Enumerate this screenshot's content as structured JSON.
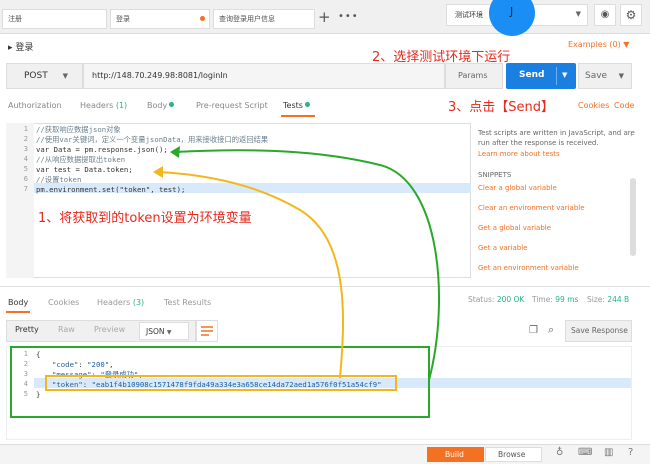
{
  "tabs": [
    {
      "label": "注册"
    },
    {
      "label": "登录"
    },
    {
      "label": "查询登录用户信息"
    }
  ],
  "environment": {
    "selected": "测试环境"
  },
  "avatar": {
    "label": "J"
  },
  "request": {
    "title": "登录",
    "examples": "Examples (0)",
    "method": "POST",
    "url": "http://148.70.249.98:8081/loginIn",
    "params": "Params",
    "send": "Send",
    "save": "Save"
  },
  "request_tabs": {
    "authorization": "Authorization",
    "headers": "Headers",
    "headers_count": "(1)",
    "body": "Body",
    "prerequest": "Pre-request Script",
    "tests": "Tests",
    "cookies": "Cookies",
    "code": "Code"
  },
  "annotations": {
    "step1": "1、将获取到的token设置为环境变量",
    "step2": "2、选择测试环境下运行",
    "step3": "3、点击【Send】"
  },
  "tests_code": {
    "line_numbers": [
      "1",
      "2",
      "3",
      "4",
      "5",
      "6",
      "7"
    ],
    "lines": [
      "//获取响应数据json对象",
      "//使用var关键词，定义一个变量jsonData，用来接收接口的返回结果",
      "var Data = pm.response.json();",
      "//从响应数据提取出token",
      "var test = Data.token;",
      "//设置token",
      "pm.environment.set(\"token\", test);"
    ]
  },
  "snippets_panel": {
    "description_1": "Test scripts are written in JavaScript, and are",
    "description_2": "run after the response is received.",
    "learn_more": "Learn more about tests",
    "heading": "SNIPPETS",
    "items": [
      "Clear a global variable",
      "Clear an environment variable",
      "Get a global variable",
      "Get a variable",
      "Get an environment variable"
    ]
  },
  "response_tabs": {
    "body": "Body",
    "cookies": "Cookies",
    "headers": "Headers",
    "headers_count": "(3)",
    "test_results": "Test Results"
  },
  "response_status": {
    "status_label": "Status:",
    "status_value": "200 OK",
    "time_label": "Time:",
    "time_value": "99 ms",
    "size_label": "Size:",
    "size_value": "244 B"
  },
  "response_toolbar": {
    "pretty": "Pretty",
    "raw": "Raw",
    "preview": "Preview",
    "format": "JSON",
    "save_response": "Save Response"
  },
  "response_body": {
    "line_numbers": [
      "1",
      "2",
      "3",
      "4",
      "5"
    ],
    "open_brace": "{",
    "code_key": "\"code\"",
    "code_value": "\"200\"",
    "message_key": "\"message\"",
    "message_value": "\"登录成功\"",
    "token_key": "\"token\"",
    "token_value": "\"eab1f4b10908c1571478f9fda49a334e3a658ce14da72aed1a576f0f51a54cf9\"",
    "close_brace": "}"
  },
  "bottom_bar": {
    "build": "Build",
    "browse": "Browse"
  },
  "colors": {
    "accent": "#f47023",
    "send_blue": "#1b7fe2",
    "annotation_red": "#e8291c",
    "arrow_green": "#2aa82a",
    "arrow_yellow": "#f3b71e",
    "success_green": "#26b47f"
  },
  "icons": {
    "plus": "plus-icon",
    "more": "more-icon",
    "eye": "eye-icon",
    "gear": "gear-icon",
    "copy": "copy-icon",
    "search": "search-icon",
    "wrap": "wrap-lines-icon"
  }
}
